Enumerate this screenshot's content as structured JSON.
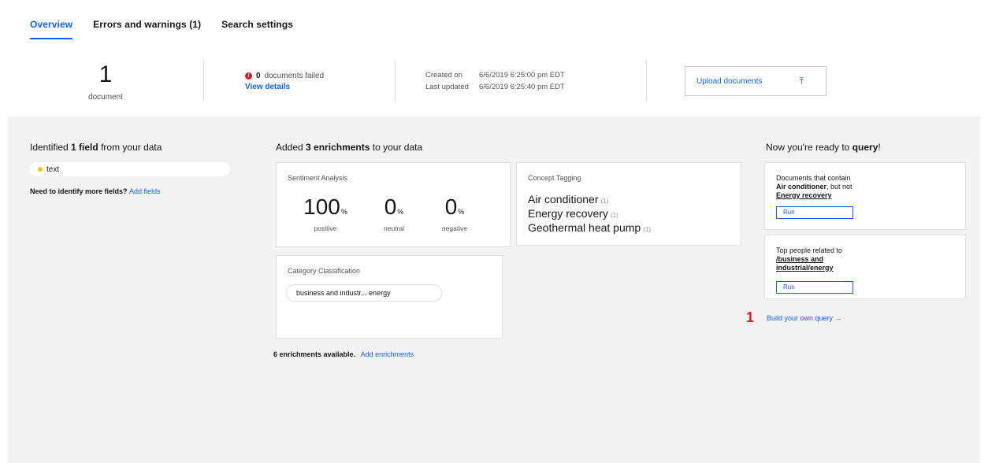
{
  "tabs": [
    {
      "label": "Overview",
      "active": true
    },
    {
      "label": "Errors and warnings (1)",
      "active": false
    },
    {
      "label": "Search settings",
      "active": false
    }
  ],
  "summary": {
    "doc_count": "1",
    "doc_label": "document",
    "failed_count": "0",
    "failed_text": "documents failed",
    "view_details": "View details",
    "created_label": "Created on",
    "created_value": "6/6/2019 6:25:00 pm EDT",
    "updated_label": "Last updated",
    "updated_value": "6/6/2019 6:25:40 pm EDT",
    "upload_label": "Upload documents"
  },
  "fields": {
    "title_pre": "Identified ",
    "title_bold": "1 field",
    "title_post": " from your data",
    "field_name": "text",
    "more_text": "Need to identify more fields?",
    "more_link": "Add fields"
  },
  "enrichments": {
    "title_pre": "Added ",
    "title_bold": "3 enrichments",
    "title_post": " to your data",
    "sentiment": {
      "title": "Sentiment Analysis",
      "stats": [
        {
          "value": "100",
          "unit": "%",
          "label": "positive"
        },
        {
          "value": "0",
          "unit": "%",
          "label": "neutral"
        },
        {
          "value": "0",
          "unit": "%",
          "label": "negative"
        }
      ]
    },
    "concepts": {
      "title": "Concept Tagging",
      "items": [
        {
          "label": "Air conditioner",
          "count": "(1)"
        },
        {
          "label": "Energy recovery",
          "count": "(1)"
        },
        {
          "label": "Geothermal heat pump",
          "count": "(1)"
        }
      ]
    },
    "category": {
      "title": "Category Classification",
      "value": "business and industr... energy"
    },
    "available_text": "6 enrichments available.",
    "available_link": "Add enrichments"
  },
  "query": {
    "title_pre": "Now you're ready to ",
    "title_bold": "query",
    "title_post": "!",
    "card1": {
      "line1": "Documents that contain",
      "bold1": "Air conditioner",
      "mid": ", but not",
      "bold2": "Energy recovery",
      "run": "Run"
    },
    "card2": {
      "line1": "Top people related to",
      "bold1": "/business and industrial/energy",
      "run": "Run"
    },
    "step": "1",
    "build_link": "Build your own query →"
  },
  "colors": {
    "accent": "#0f62fe",
    "error": "#da1e28",
    "bg_gray": "#f2f2f2"
  }
}
